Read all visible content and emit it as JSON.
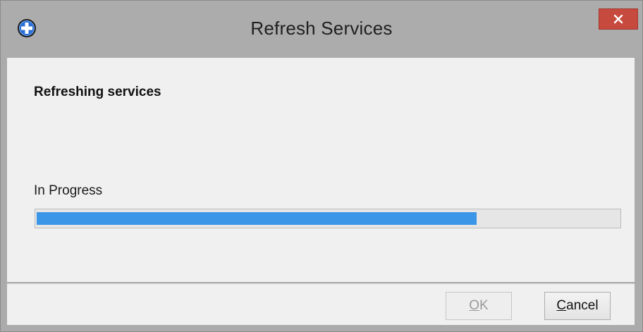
{
  "window": {
    "title": "Refresh Services",
    "icon": "blue-cross-circle-icon",
    "close_icon": "close-x-icon",
    "close_color": "#c74a3f"
  },
  "content": {
    "heading": "Refreshing services",
    "progress_label": "In Progress",
    "progress_fraction": 0.755,
    "progress_color": "#3c96e8"
  },
  "footer": {
    "ok": {
      "mnemonic": "O",
      "rest": "K",
      "enabled": false
    },
    "cancel": {
      "mnemonic": "C",
      "rest": "ancel",
      "enabled": true
    }
  }
}
